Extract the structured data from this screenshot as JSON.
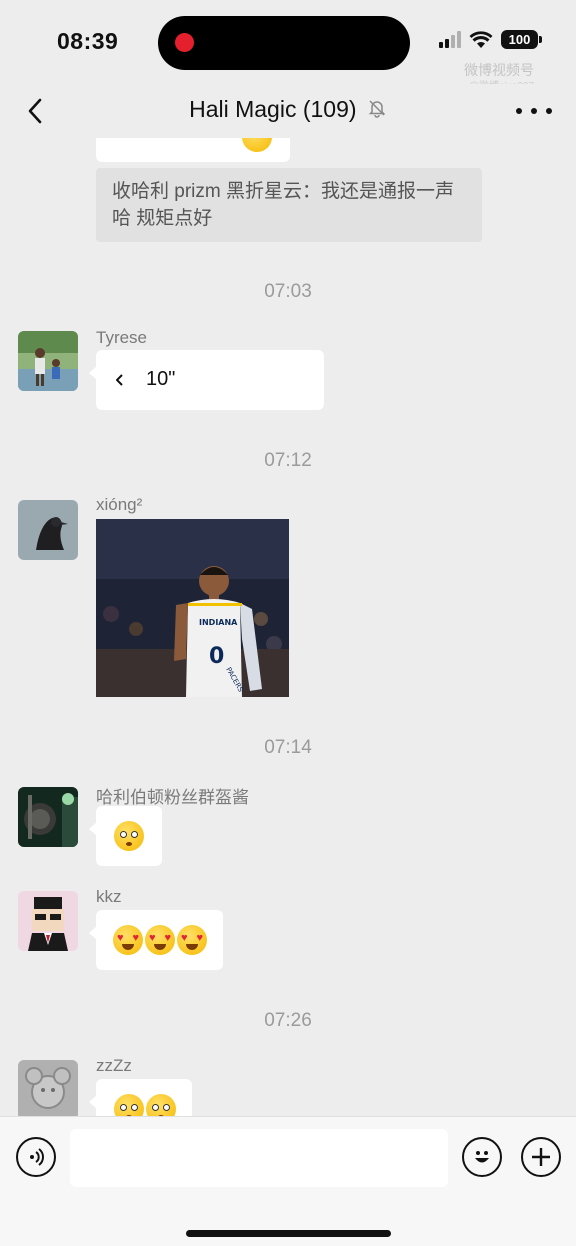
{
  "status_bar": {
    "time": "08:39",
    "battery": "100",
    "watermark": "微博视频号",
    "watermark_sub": "@微博pixo007"
  },
  "header": {
    "title": "Hali Magic (109)",
    "back_icon": "chevron-left-icon",
    "mute_icon": "bell-slash-icon",
    "more_icon": "ellipsis-icon"
  },
  "chat": {
    "top_partial_emoji": "😅",
    "quote_text": "收哈利 prizm 黑折星云：我还是通报一声哈 规矩点好",
    "messages": [
      {
        "time": "07:03",
        "sender": "Tyrese",
        "kind": "voice",
        "duration": "10\""
      },
      {
        "time": "07:12",
        "sender": "xióng²",
        "kind": "image",
        "image_desc": "basketball player jersey INDIANA PACERS 0"
      },
      {
        "time": "07:14",
        "sender": "哈利伯顿粉丝群盔酱",
        "kind": "emoji",
        "emojis": [
          "flushed"
        ]
      },
      {
        "sender": "kkz",
        "kind": "emoji",
        "emojis": [
          "heart-eyes",
          "heart-eyes",
          "heart-eyes"
        ]
      },
      {
        "time": "07:26",
        "sender": "zzZz",
        "kind": "emoji",
        "emojis": [
          "flushed",
          "flushed"
        ]
      }
    ],
    "jersey_team": "INDIANA",
    "jersey_team2": "PACERS",
    "jersey_number": "0"
  },
  "input_bar": {
    "voice_icon": "voice-icon",
    "emoji_icon": "smiley-icon",
    "plus_icon": "plus-icon",
    "placeholder": ""
  },
  "colors": {
    "background": "#ededed",
    "bubble": "#ffffff",
    "quote_bg": "#e1e1e1",
    "timestamp": "#9b9b9b",
    "record_dot": "#e5202e"
  }
}
